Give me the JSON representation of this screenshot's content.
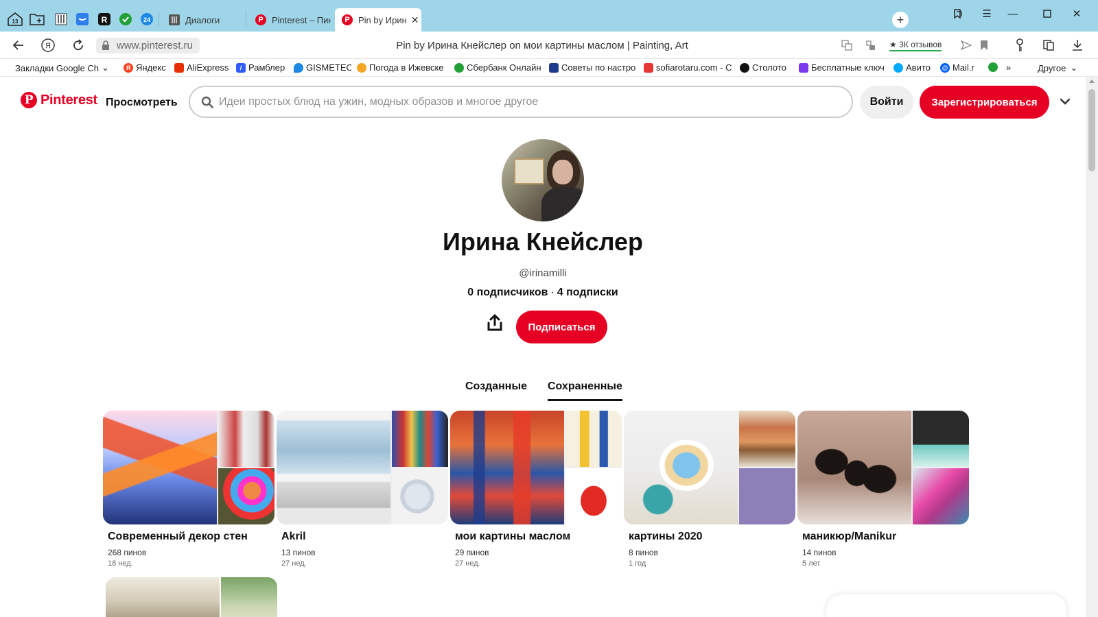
{
  "browser": {
    "tabs": [
      {
        "label": "Диалоги",
        "icon": "grid-favicon-icon"
      },
      {
        "label": "Pinterest – Пин",
        "icon": "pinterest-favicon-icon"
      },
      {
        "label": "Pin by Ирин",
        "icon": "pinterest-favicon-icon"
      }
    ],
    "tab_badge_13": "13",
    "tab_badge_24": "24",
    "url": "www.pinterest.ru",
    "page_title": "Pin by Ирина Кнейслер on мои картины маслом | Painting, Art",
    "reviews": "★ 3К отзывов",
    "bookmarks": [
      {
        "label": "Закладки Google Ch",
        "color": "#ffffff"
      },
      {
        "label": "Яндекс",
        "color": "#fc3f1d"
      },
      {
        "label": "AliExpress",
        "color": "#e62e04"
      },
      {
        "label": "Рамблер",
        "color": "#315efb"
      },
      {
        "label": "GISMETEO",
        "color": "#1e88e5"
      },
      {
        "label": "Погода в Ижевске",
        "color": "#f5a623"
      },
      {
        "label": "Сбербанк Онлайн",
        "color": "#21a038"
      },
      {
        "label": "Советы по настро",
        "color": "#1e3a8a"
      },
      {
        "label": "sofiarotaru.com - С",
        "color": "#e53935"
      },
      {
        "label": "Столото",
        "color": "#111111"
      },
      {
        "label": "Бесплатные ключ",
        "color": "#7c3aed"
      },
      {
        "label": "Авито",
        "color": "#00aaff"
      },
      {
        "label": "Mail.r",
        "color": "#005ff9"
      }
    ],
    "bookmarks_more": "»",
    "bookmarks_other": "Другое"
  },
  "header": {
    "logo_text": "Pinterest",
    "browse_label": "Просмотреть",
    "search_placeholder": "Идеи простых блюд на ужин, модных образов и многое другое",
    "login_label": "Войти",
    "signup_label": "Зарегистрироваться"
  },
  "profile": {
    "name": "Ирина Кнейслер",
    "handle": "@irinamilli",
    "followers": "0 подписчиков",
    "following": "4 подписки",
    "follow_label": "Подписаться"
  },
  "profile_tabs": [
    {
      "label": "Созданные",
      "active": false
    },
    {
      "label": "Сохраненные",
      "active": true
    }
  ],
  "boards": [
    {
      "title": "Современный декор стен",
      "pins": "268 пинов",
      "age": "18 нед."
    },
    {
      "title": "Akril",
      "pins": "13 пинов",
      "age": "27 нед."
    },
    {
      "title": "мои картины маслом",
      "pins": "29 пинов",
      "age": "27 нед."
    },
    {
      "title": "картины 2020",
      "pins": "8 пинов",
      "age": "1 год"
    },
    {
      "title": "маникюр/Manikur",
      "pins": "14 пинов",
      "age": "5 лет"
    }
  ],
  "colors": {
    "brand": "#e60023",
    "tabbar": "#9ed5e8"
  }
}
